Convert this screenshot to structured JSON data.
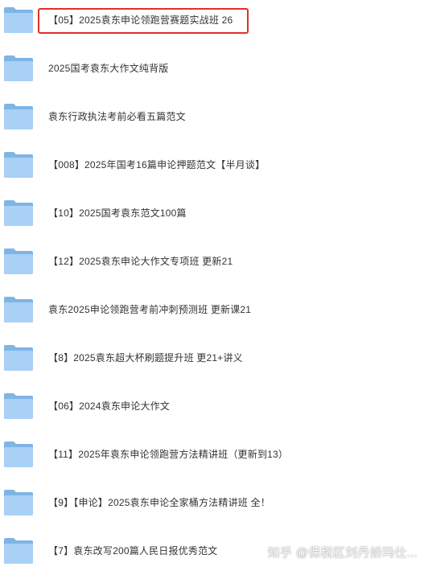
{
  "folders": [
    {
      "label": "【05】2025袁东申论领跑营赛题实战班 26",
      "icon": "folder-icon",
      "highlighted": true
    },
    {
      "label": "2025国考袁东大作文纯背版",
      "icon": "folder-icon"
    },
    {
      "label": "袁东行政执法考前必看五篇范文",
      "icon": "folder-icon"
    },
    {
      "label": "【008】2025年国考16篇申论押题范文【半月谈】",
      "icon": "folder-icon"
    },
    {
      "label": "【10】2025国考袁东范文100篇",
      "icon": "folder-icon"
    },
    {
      "label": "【12】2025袁东申论大作文专项班 更新21",
      "icon": "folder-icon"
    },
    {
      "label": "袁东2025申论领跑营考前冲刺预测班 更新课21",
      "icon": "folder-icon"
    },
    {
      "label": "【8】2025袁东超大杯刷题提升班 更21+讲义",
      "icon": "folder-icon"
    },
    {
      "label": "【06】2024袁东申论大作文",
      "icon": "folder-icon"
    },
    {
      "label": "【11】2025年袁东申论领跑营方法精讲班（更新到13）",
      "icon": "folder-icon"
    },
    {
      "label": "【9】【申论】2025袁东申论全家桶方法精讲班 全！",
      "icon": "folder-icon"
    },
    {
      "label": "【7】袁东改写200篇人民日报优秀范文",
      "icon": "folder-icon"
    }
  ],
  "watermark": "知乎 @保税区刘丹娇玛仕...",
  "colors": {
    "highlight_border": "#e0302b",
    "folder_back": "#7fb4e6",
    "folder_front": "#a9d0f5",
    "text": "#333333"
  }
}
